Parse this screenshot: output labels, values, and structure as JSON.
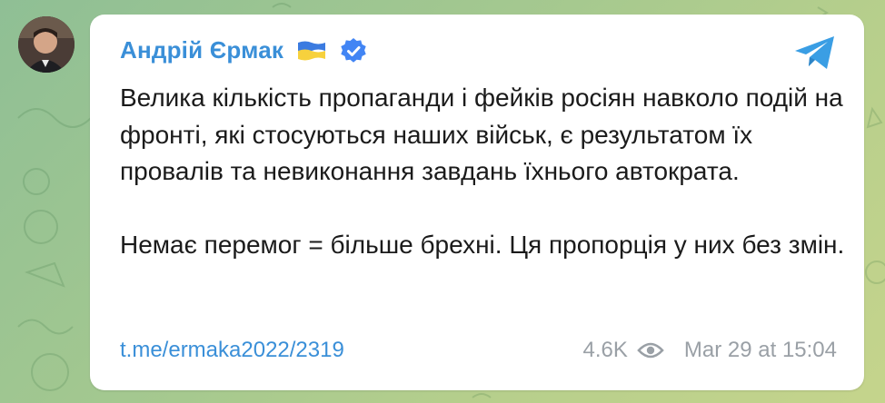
{
  "post": {
    "author": {
      "name": "Андрій Єрмак",
      "flag_icon": "ukraine-flag-icon",
      "verified_icon": "verified-badge-icon"
    },
    "message": {
      "paragraph_1": "Велика кількість пропаганди і фейків росіян навколо подій на фронті, які стосуються наших військ, є результатом їх провалів та невиконання завдань їхнього автократа.",
      "paragraph_2": "Немає перемог = більше брехні. Ця пропорція у них без змін."
    },
    "link": "t.me/ermaka2022/2319",
    "views": "4.6K",
    "timestamp": "Mar 29 at 15:04",
    "platform_icon": "telegram-icon"
  },
  "colors": {
    "accent": "#3a8fd8",
    "verified": "#4285f4",
    "meta_text": "#9aa0a6",
    "message_text": "#1b1b1b",
    "background": "#a6c98f"
  }
}
